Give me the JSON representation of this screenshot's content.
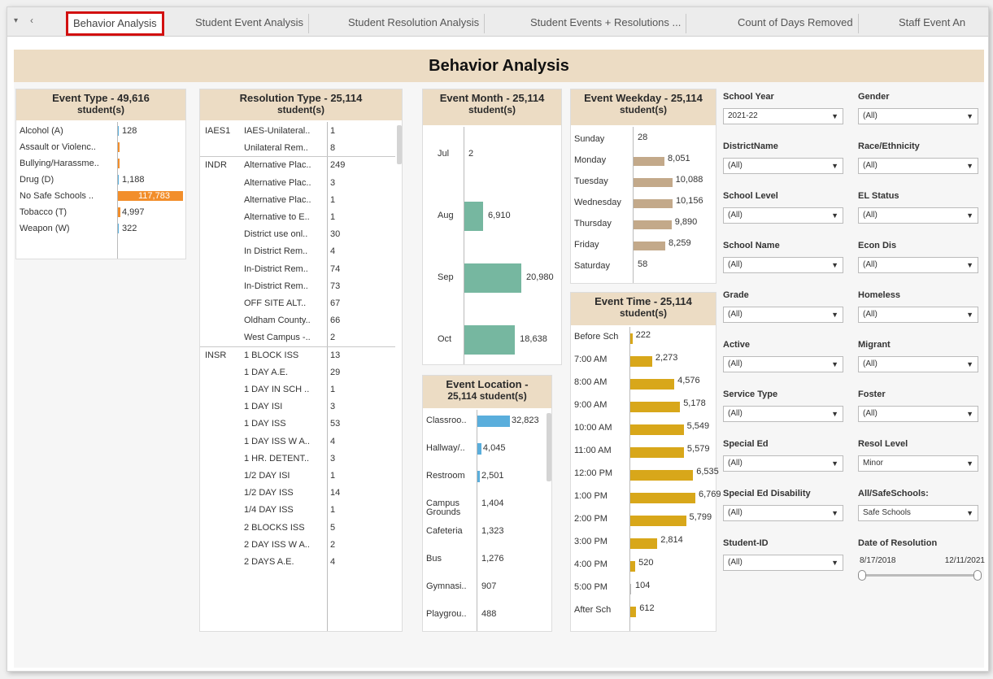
{
  "tabs": {
    "controls": [
      "▾",
      "‹"
    ],
    "items": [
      "Behavior Analysis",
      "Student Event Analysis",
      "Student Resolution Analysis",
      "Student Events + Resolutions ...",
      "Count of Days Removed",
      "Staff Event An"
    ]
  },
  "title": "Behavior Analysis",
  "event_type": {
    "title": "Event Type",
    "count": "- 49,616",
    "unit": "student(s)",
    "rows": [
      {
        "label": "Alcohol (A)",
        "value": "128",
        "bar": 0.001
      },
      {
        "label": "Assault or Violenc..",
        "value": "",
        "bar": 0.02
      },
      {
        "label": "Bullying/Harassme..",
        "value": "",
        "bar": 0.02
      },
      {
        "label": "Drug (D)",
        "value": "1,188",
        "bar": 0.01
      },
      {
        "label": "No Safe Schools ..",
        "value": "117,783",
        "bar": 1.0
      },
      {
        "label": "Tobacco (T)",
        "value": "4,997",
        "bar": 0.04
      },
      {
        "label": "Weapon (W)",
        "value": "322",
        "bar": 0.003
      }
    ],
    "bar_color": "#f28e2b"
  },
  "resolution_type": {
    "title": "Resolution Type",
    "count": "- 25,114",
    "unit": "student(s)",
    "groups": [
      {
        "code": "IAES1",
        "rows": [
          [
            "IAES-Unilateral..",
            "1"
          ],
          [
            "Unilateral Rem..",
            "8"
          ]
        ]
      },
      {
        "code": "INDR",
        "rows": [
          [
            "Alternative Plac..",
            "249"
          ],
          [
            "Alternative Plac..",
            "3"
          ],
          [
            "Alternative Plac..",
            "1"
          ],
          [
            "Alternative to E..",
            "1"
          ],
          [
            "District use onl..",
            "30"
          ],
          [
            "In District Rem..",
            "4"
          ],
          [
            "In-District Rem..",
            "74"
          ],
          [
            "In-District Rem..",
            "73"
          ],
          [
            "OFF SITE ALT..",
            "67"
          ],
          [
            "Oldham County..",
            "66"
          ],
          [
            "West Campus -..",
            "2"
          ]
        ]
      },
      {
        "code": "INSR",
        "rows": [
          [
            "1 BLOCK ISS",
            "13"
          ],
          [
            "1 DAY A.E.",
            "29"
          ],
          [
            "1 DAY IN SCH ..",
            "1"
          ],
          [
            "1 DAY ISI",
            "3"
          ],
          [
            "1 DAY ISS",
            "53"
          ],
          [
            "1 DAY ISS W A..",
            "4"
          ],
          [
            "1 HR. DETENT..",
            "3"
          ],
          [
            "1/2 DAY ISI",
            "1"
          ],
          [
            "1/2 DAY ISS",
            "14"
          ],
          [
            "1/4 DAY ISS",
            "1"
          ],
          [
            "2 BLOCKS ISS",
            "5"
          ],
          [
            "2 DAY ISS W A..",
            "2"
          ],
          [
            "2 DAYS A.E.",
            "4"
          ]
        ]
      }
    ]
  },
  "event_month": {
    "title": "Event Month",
    "count": "- 25,114",
    "unit": "student(s)",
    "bar_color": "#76b7a0",
    "rows": [
      {
        "label": "Jul",
        "value": "2",
        "num": 2
      },
      {
        "label": "Aug",
        "value": "6,910",
        "num": 6910
      },
      {
        "label": "Sep",
        "value": "20,980",
        "num": 20980
      },
      {
        "label": "Oct",
        "value": "18,638",
        "num": 18638
      }
    ]
  },
  "event_weekday": {
    "title": "Event Weekday",
    "count": "- 25,114",
    "unit": "student(s)",
    "bar_color": "#c3a98a",
    "rows": [
      {
        "label": "Sunday",
        "value": "28",
        "num": 28
      },
      {
        "label": "Monday",
        "value": "8,051",
        "num": 8051
      },
      {
        "label": "Tuesday",
        "value": "10,088",
        "num": 10088
      },
      {
        "label": "Wednesday",
        "value": "10,156",
        "num": 10156
      },
      {
        "label": "Thursday",
        "value": "9,890",
        "num": 9890
      },
      {
        "label": "Friday",
        "value": "8,259",
        "num": 8259
      },
      {
        "label": "Saturday",
        "value": "58",
        "num": 58
      }
    ]
  },
  "event_location": {
    "title": "Event Location",
    "count": "-",
    "count2": "25,114 student(s)",
    "bar_color": "#5aaedc",
    "rows": [
      {
        "label": "Classroo..",
        "value": "32,823",
        "num": 32823
      },
      {
        "label": "Hallway/..",
        "value": "4,045",
        "num": 4045
      },
      {
        "label": "Restroom",
        "value": "2,501",
        "num": 2501
      },
      {
        "label": "Campus Grounds",
        "value": "1,404",
        "num": 0
      },
      {
        "label": "Cafeteria",
        "value": "1,323",
        "num": 0
      },
      {
        "label": "Bus",
        "value": "1,276",
        "num": 0
      },
      {
        "label": "Gymnasi..",
        "value": "907",
        "num": 0
      },
      {
        "label": "Playgrou..",
        "value": "488",
        "num": 0
      }
    ]
  },
  "event_time": {
    "title": "Event Time",
    "count": "- 25,114",
    "unit": "student(s)",
    "bar_color": "#d8a71a",
    "rows": [
      {
        "label": "Before Sch",
        "value": "222",
        "num": 222
      },
      {
        "label": "7:00 AM",
        "value": "2,273",
        "num": 2273
      },
      {
        "label": "8:00 AM",
        "value": "4,576",
        "num": 4576
      },
      {
        "label": "9:00 AM",
        "value": "5,178",
        "num": 5178
      },
      {
        "label": "10:00 AM",
        "value": "5,549",
        "num": 5549
      },
      {
        "label": "11:00 AM",
        "value": "5,579",
        "num": 5579
      },
      {
        "label": "12:00 PM",
        "value": "6,535",
        "num": 6535
      },
      {
        "label": "1:00 PM",
        "value": "6,769",
        "num": 6769
      },
      {
        "label": "2:00 PM",
        "value": "5,799",
        "num": 5799
      },
      {
        "label": "3:00 PM",
        "value": "2,814",
        "num": 2814
      },
      {
        "label": "4:00 PM",
        "value": "520",
        "num": 520
      },
      {
        "label": "5:00 PM",
        "value": "104",
        "num": 104
      },
      {
        "label": "After Sch",
        "value": "612",
        "num": 612
      }
    ]
  },
  "filters": [
    [
      {
        "label": "School Year",
        "value": "2021-22"
      },
      {
        "label": "Gender",
        "value": "(All)"
      }
    ],
    [
      {
        "label": "DistrictName",
        "value": "(All)"
      },
      {
        "label": "Race/Ethnicity",
        "value": "(All)"
      }
    ],
    [
      {
        "label": "School Level",
        "value": "(All)"
      },
      {
        "label": "EL Status",
        "value": "(All)"
      }
    ],
    [
      {
        "label": "School Name",
        "value": "(All)"
      },
      {
        "label": "Econ Dis",
        "value": "(All)"
      }
    ],
    [
      {
        "label": "Grade",
        "value": "(All)"
      },
      {
        "label": "Homeless",
        "value": "(All)"
      }
    ],
    [
      {
        "label": "Active",
        "value": "(All)"
      },
      {
        "label": "Migrant",
        "value": "(All)"
      }
    ],
    [
      {
        "label": "Service Type",
        "value": "(All)"
      },
      {
        "label": "Foster",
        "value": "(All)"
      }
    ],
    [
      {
        "label": "Special Ed",
        "value": "(All)"
      },
      {
        "label": "Resol Level",
        "value": "Minor"
      }
    ],
    [
      {
        "label": "Special Ed Disability",
        "value": "(All)"
      },
      {
        "label": "All/SafeSchools:",
        "value": "Safe Schools"
      }
    ],
    [
      {
        "label": "Student-ID",
        "value": "(All)"
      }
    ]
  ],
  "date_filter": {
    "label": "Date of Resolution",
    "start": "8/17/2018",
    "end": "12/11/2021",
    "range": [
      0,
      1
    ]
  },
  "icons": {
    "dropdown": "dropdown-arrow-icon"
  }
}
